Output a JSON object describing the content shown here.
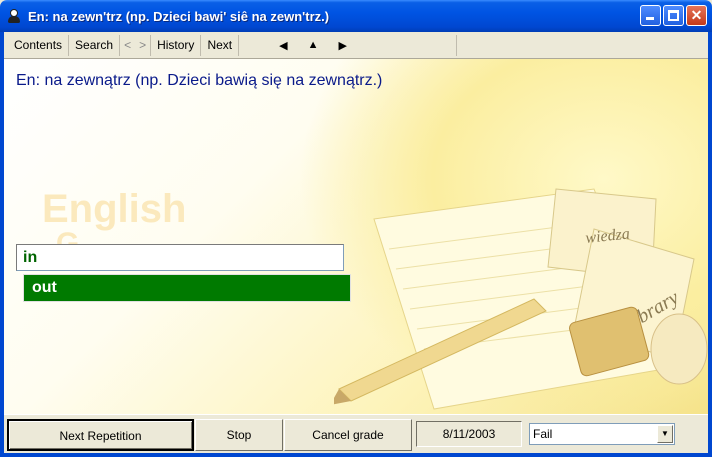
{
  "window": {
    "title": "En: na zewn'trz (np. Dzieci bawi' siê na zewn'trz.)"
  },
  "toolbar": {
    "contents": "Contents",
    "search": "Search",
    "back": "<",
    "forward": ">",
    "history": "History",
    "next": "Next",
    "nav_left": "◀",
    "nav_up": "▲",
    "nav_right": "▶"
  },
  "main": {
    "question": "En: na zewnątrz (np. Dzieci bawią się na zewnątrz.)",
    "background_word": "English",
    "background_word2": "G",
    "answer_value": "in",
    "suggestion": "out",
    "illustration_words": [
      "wiedza",
      "library"
    ]
  },
  "bottom": {
    "next_repetition": "Next Repetition",
    "stop": "Stop",
    "cancel_grade": "Cancel grade",
    "date": "8/11/2003",
    "grade": "Fail"
  },
  "colors": {
    "titlebar": "#0054e3",
    "question_text": "#0a1a8a",
    "answer_text": "#006400",
    "suggestion_bg": "#007a00"
  }
}
